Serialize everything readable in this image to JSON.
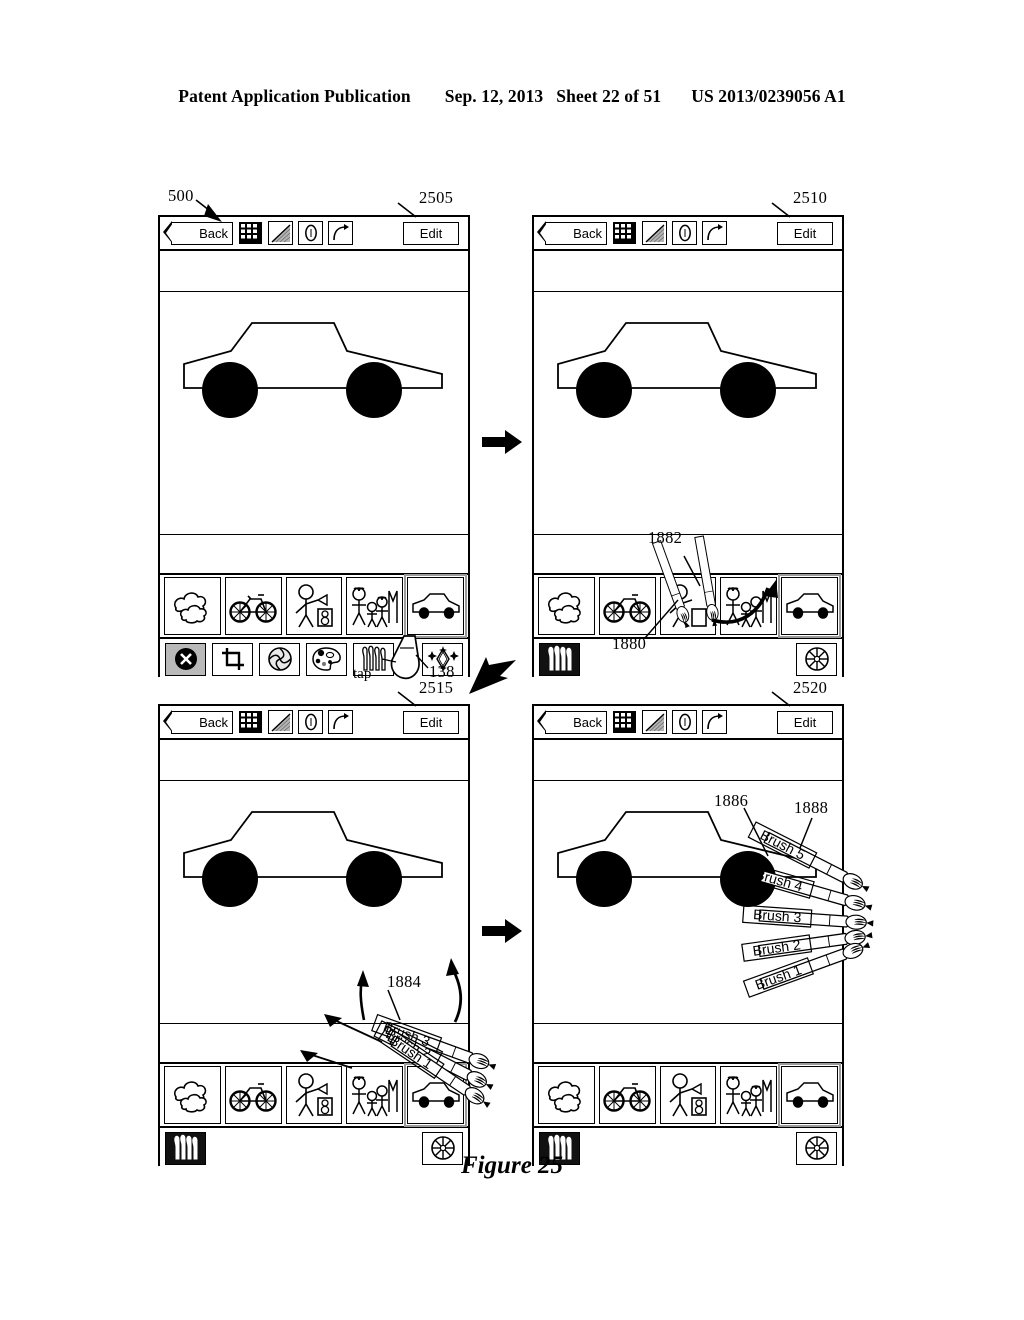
{
  "header": {
    "publication": "Patent Application Publication",
    "date": "Sep. 12, 2013",
    "sheet": "Sheet 22 of 51",
    "patent_number": "US 2013/0239056 A1"
  },
  "figure": {
    "caption": "Figure 25"
  },
  "toolbar": {
    "back_label": "Back",
    "edit_label": "Edit",
    "icons": [
      {
        "name": "grid-pattern-icon",
        "glyph": "grid"
      },
      {
        "name": "gradient-triangle-icon",
        "glyph": "gradient"
      },
      {
        "name": "oval-zero-icon",
        "glyph": "oval"
      },
      {
        "name": "curve-arrow-icon",
        "glyph": "curve"
      }
    ]
  },
  "thumbnails": [
    {
      "name": "thumbnail-clouds",
      "label": "clouds",
      "selected": false
    },
    {
      "name": "thumbnail-bicycle",
      "label": "bicycle",
      "selected": false
    },
    {
      "name": "thumbnail-stick-figure",
      "label": "stick-figure",
      "selected": false
    },
    {
      "name": "thumbnail-stick-family",
      "label": "stick-family",
      "selected": false
    },
    {
      "name": "thumbnail-car",
      "label": "car",
      "selected": true
    }
  ],
  "tools": [
    {
      "name": "close-tool",
      "glyph": "x-circle",
      "state": "highlighted"
    },
    {
      "name": "crop-tool",
      "glyph": "crop",
      "state": "normal"
    },
    {
      "name": "camera-tool",
      "glyph": "aperture",
      "state": "normal"
    },
    {
      "name": "palette-tool",
      "glyph": "palette",
      "state": "normal"
    },
    {
      "name": "brushes-tool",
      "glyph": "brushes",
      "state": "normal"
    },
    {
      "name": "effects-tool",
      "glyph": "sparkle",
      "state": "normal"
    }
  ],
  "tools_collapsed": [
    {
      "name": "brushes-tool-active",
      "glyph": "brushes-dark",
      "state": "active"
    },
    {
      "name": "color-wheel-tool",
      "glyph": "wheel",
      "state": "normal"
    }
  ],
  "panels": [
    {
      "id": "panel-2505",
      "ref": "2505",
      "extra_ref": "500"
    },
    {
      "id": "panel-2510",
      "ref": "2510"
    },
    {
      "id": "panel-2515",
      "ref": "2515"
    },
    {
      "id": "panel-2520",
      "ref": "2520"
    }
  ],
  "callouts": {
    "device_ref": "500",
    "panel_1_ref": "2505",
    "panel_2_ref": "2510",
    "panel_3_ref": "2515",
    "panel_4_ref": "2520",
    "brushes_icon_ref": "138",
    "tap_label": "tap",
    "brush_pair_ref": "1880",
    "brush_arrow_ref": "1882",
    "brush_fan_ref_3": "1884",
    "brush_fan_ref_4a": "1886",
    "brush_fan_ref_4b": "1888"
  },
  "brush_labels": {
    "panel3": [
      "Brush 3",
      "Brush 2",
      "Brush 1"
    ],
    "panel4": [
      "Brush 5",
      "Brush 4",
      "Brush 3",
      "Brush 2",
      "Brush 1"
    ]
  },
  "colors": {
    "ink": "#000000",
    "paper": "#ffffff",
    "highlight": "#b9b9b9",
    "selection_outline": "#9a9a9a"
  }
}
